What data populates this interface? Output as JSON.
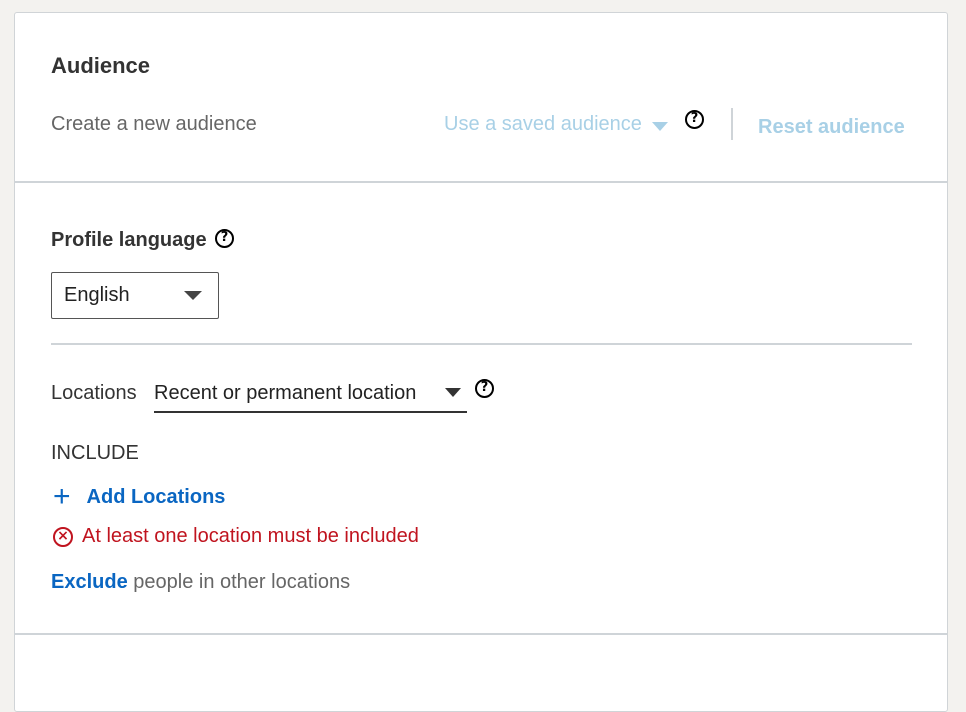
{
  "audience": {
    "title": "Audience",
    "create_label": "Create a new audience",
    "saved_audience_label": "Use a saved audience",
    "reset_label": "Reset audience"
  },
  "profile_language": {
    "label": "Profile language",
    "selected": "English"
  },
  "locations": {
    "label": "Locations",
    "type_selected": "Recent or permanent location",
    "include_label": "INCLUDE",
    "add_label": "Add Locations",
    "error_text": "At least one location must be included",
    "exclude_link": "Exclude",
    "exclude_rest": " people in other locations"
  },
  "icons": {
    "help": "?",
    "plus": "+",
    "error": "×"
  },
  "colors": {
    "link": "#0a66c2",
    "disabled_link": "#a8d0e6",
    "error": "#c0141f",
    "divider": "#cfd4d8"
  }
}
